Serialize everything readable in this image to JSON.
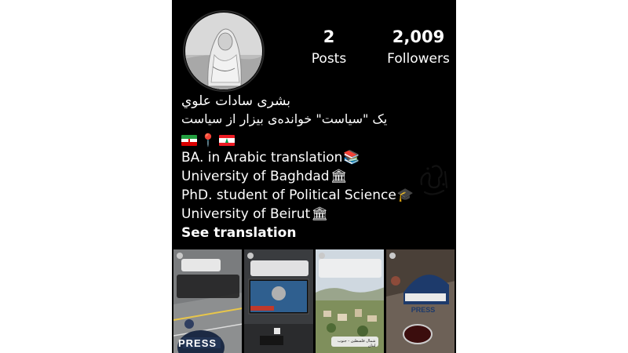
{
  "profile": {
    "posts_count": "2",
    "posts_label": "Posts",
    "followers_count": "2,009",
    "followers_label": "Followers",
    "name": "بشرى سادات علوي",
    "tagline": "یک \"سیاست\" خوانده‌ی بیزار از سیاست",
    "bio": [
      {
        "text": "BA. in Arabic translation",
        "emoji": "📚"
      },
      {
        "text": "University of Baghdad",
        "emoji": "🏛"
      },
      {
        "text": "PhD. student of Political Science",
        "emoji": "🎓"
      },
      {
        "text": "University of Beirut",
        "emoji": "🏛"
      }
    ],
    "see_translation": "See translation"
  },
  "posts": [
    {
      "caption": "PRESS"
    },
    {
      "caption": ""
    },
    {
      "caption": "شمال فلسطين - جنوب لبنان"
    },
    {
      "caption": "PRESS"
    }
  ],
  "colors": {
    "background": "#000000",
    "text": "#ffffff",
    "page_margin": "#ffffff"
  }
}
